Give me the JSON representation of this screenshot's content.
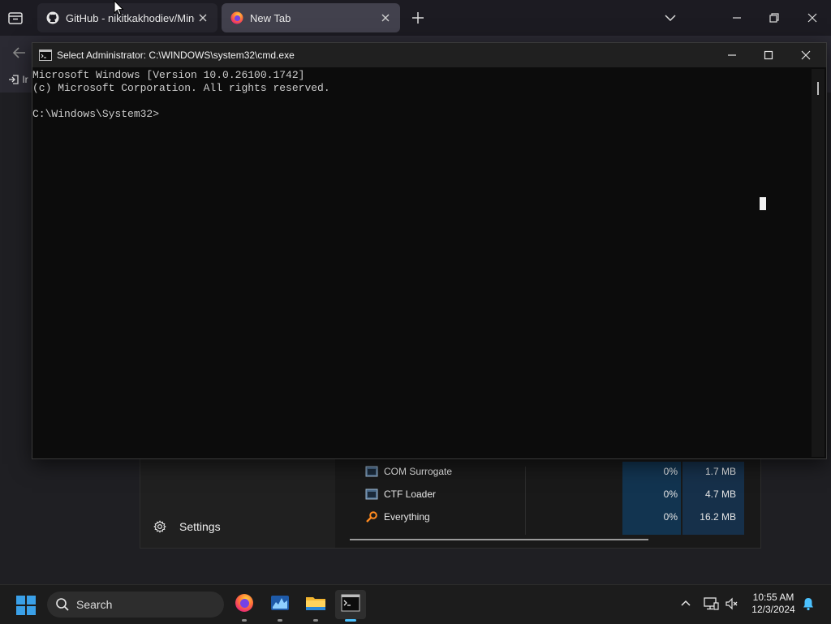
{
  "browser": {
    "tabs": [
      {
        "title": "GitHub - nikitkakhodiev/Mine",
        "favicon": "github-icon",
        "active": false
      },
      {
        "title": "New Tab",
        "favicon": "firefox-icon",
        "active": true
      }
    ],
    "import_label": "Ir"
  },
  "cmd": {
    "title": "Select Administrator: C:\\WINDOWS\\system32\\cmd.exe",
    "lines": [
      "Microsoft Windows [Version 10.0.26100.1742]",
      "(c) Microsoft Corporation. All rights reserved.",
      "",
      "C:\\Windows\\System32>"
    ]
  },
  "taskmgr": {
    "settings_label": "Settings",
    "processes": [
      {
        "name": "COM Surrogate",
        "cpu": "0%",
        "memory": "1.7 MB",
        "icon": "process-window-icon"
      },
      {
        "name": "CTF Loader",
        "cpu": "0%",
        "memory": "4.7 MB",
        "icon": "process-window-icon"
      },
      {
        "name": "Everything",
        "cpu": "0%",
        "memory": "16.2 MB",
        "icon": "magnifier-icon"
      }
    ]
  },
  "taskbar": {
    "search_placeholder": "Search",
    "apps": [
      "firefox-icon",
      "task-manager-icon",
      "file-explorer-icon",
      "terminal-icon"
    ],
    "active_app": "terminal-icon",
    "time": "10:55 AM",
    "date": "12/3/2024"
  },
  "colors": {
    "accent": "#4cc2ff",
    "console_bg": "#0c0c0c",
    "console_text": "#cccccc"
  }
}
